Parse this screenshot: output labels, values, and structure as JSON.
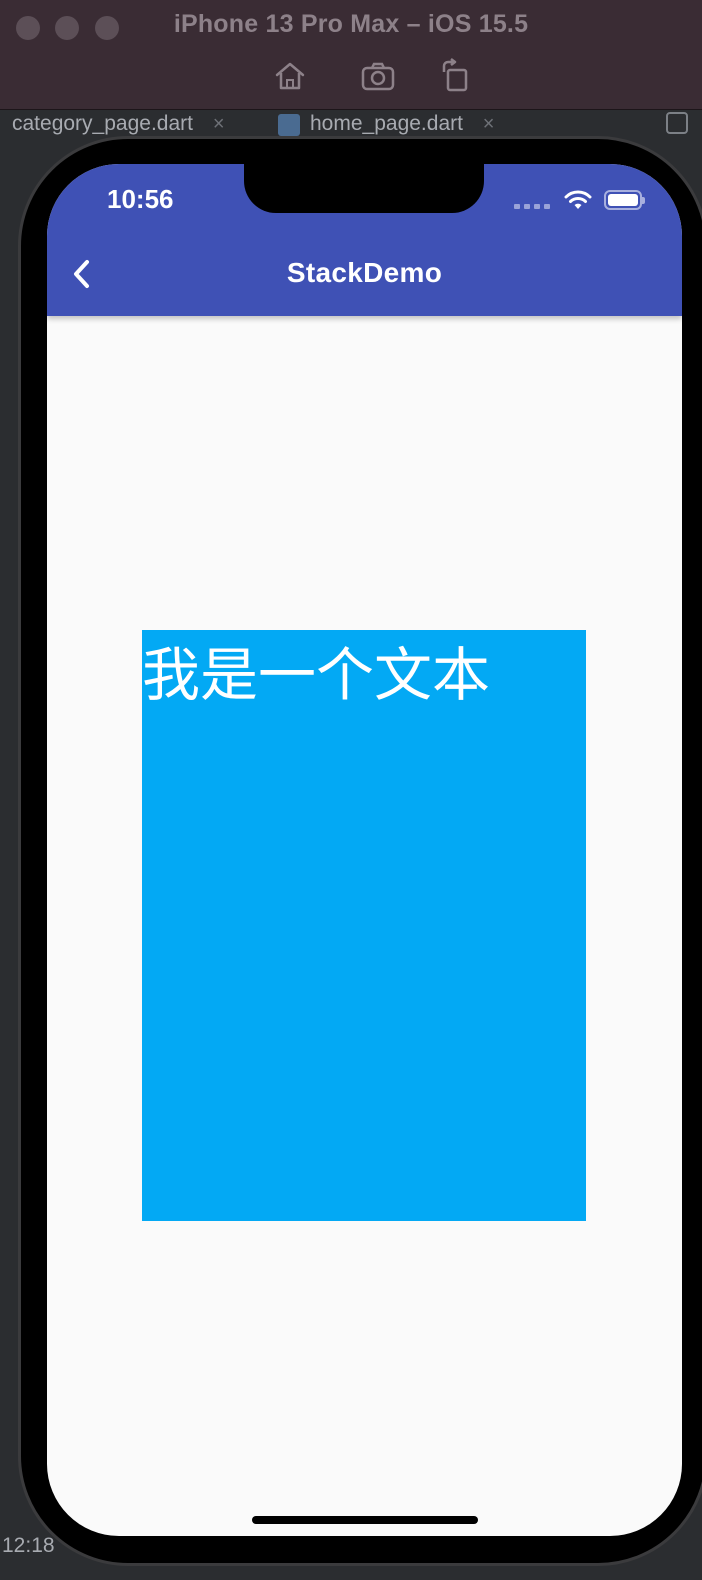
{
  "simulator": {
    "title": "iPhone 13 Pro Max – iOS 15.5",
    "toolbar": {
      "home_icon": "home-icon",
      "screenshot_icon": "camera-icon",
      "rotate_icon": "rotate-icon"
    }
  },
  "ide": {
    "tabs": [
      {
        "label": "category_page.dart"
      },
      {
        "label": "home_page.dart"
      }
    ],
    "close_glyph": "×",
    "bottom_time": "12:18"
  },
  "status_bar": {
    "time": "10:56"
  },
  "app_bar": {
    "title": "StackDemo",
    "back_icon": "chevron-left-icon"
  },
  "content": {
    "stack_text": "我是一个文本"
  },
  "colors": {
    "app_bar": "#3f51b5",
    "stack_box": "#03a9f4",
    "background": "#fafafa"
  }
}
